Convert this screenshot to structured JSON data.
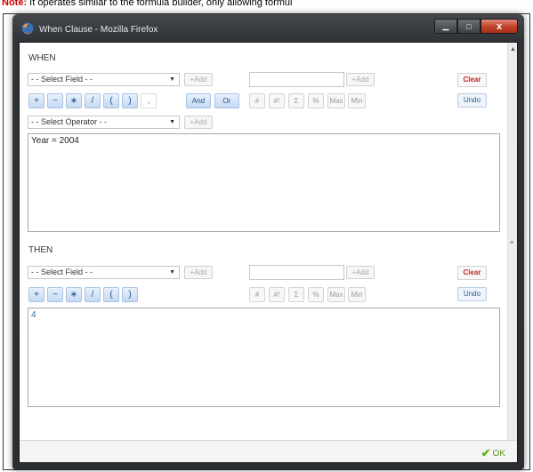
{
  "doc_note": {
    "label": "Note:",
    "text": "It operates similar to the formula builder, only allowing formul"
  },
  "window": {
    "title": "When Clause - Mozilla Firefox",
    "controls": {
      "minimize": "▁",
      "maximize": "□",
      "close": "x"
    }
  },
  "when": {
    "heading": "WHEN",
    "field_select": "- - Select Field - -",
    "add_field": "+Add",
    "value_add": "+Add",
    "clear": "Clear",
    "undo": "Undo",
    "operators": [
      "+",
      "−",
      "∗",
      "/",
      "(",
      ")",
      ","
    ],
    "and_label": "And",
    "or_label": "Or",
    "functions": [
      "#",
      "#!",
      "Σ",
      "%",
      "Max",
      "Min"
    ],
    "operator_select": "- - Select Operator - -",
    "operator_add": "+Add",
    "expression": "Year = 2004"
  },
  "then": {
    "heading": "THEN",
    "field_select": "- - Select Field - -",
    "add_field": "+Add",
    "value_add": "+Add",
    "clear": "Clear",
    "undo": "Undo",
    "operators": [
      "+",
      "−",
      "∗",
      "/",
      "(",
      ")"
    ],
    "functions": [
      "#",
      "#!",
      "Σ",
      "%",
      "Max",
      "Min"
    ],
    "expression": "4"
  },
  "footer": {
    "ok": "OK"
  }
}
